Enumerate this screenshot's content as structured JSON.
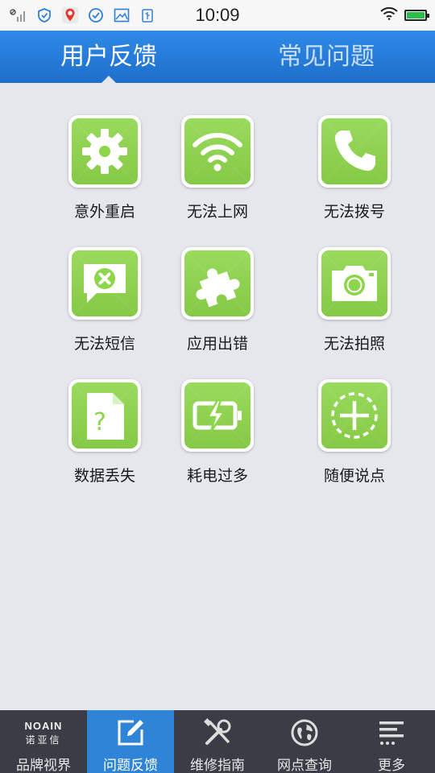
{
  "status_bar": {
    "time": "10:09",
    "icons": [
      "signal-off-icon",
      "shield-check-icon",
      "map-pin-app-icon",
      "check-circle-icon",
      "image-icon",
      "usb-icon"
    ],
    "right_icons": [
      "wifi-icon",
      "battery-icon"
    ],
    "battery_level": 1.0,
    "battery_color": "#2bbf4a"
  },
  "header": {
    "tabs": [
      {
        "label": "用户反馈",
        "active": true
      },
      {
        "label": "常见问题",
        "active": false
      }
    ],
    "color": "#2a7fdc"
  },
  "grid": {
    "tile_color": "#8dd64a",
    "items": [
      {
        "label": "意外重启",
        "icon": "gear-icon"
      },
      {
        "label": "无法上网",
        "icon": "wifi-icon"
      },
      {
        "label": "无法拨号",
        "icon": "phone-icon"
      },
      {
        "label": "无法短信",
        "icon": "message-error-icon"
      },
      {
        "label": "应用出错",
        "icon": "puzzle-icon"
      },
      {
        "label": "无法拍照",
        "icon": "camera-icon"
      },
      {
        "label": "数据丢失",
        "icon": "file-question-icon"
      },
      {
        "label": "耗电过多",
        "icon": "battery-charging-icon"
      },
      {
        "label": "随便说点",
        "icon": "plus-circle-dashed-icon"
      }
    ]
  },
  "bottom_nav": {
    "brand_en": "NOAIN",
    "brand_cn": "诺亚信",
    "items": [
      {
        "label": "品牌视界",
        "icon": "brand-logo-icon",
        "active": false
      },
      {
        "label": "问题反馈",
        "icon": "edit-icon",
        "active": true
      },
      {
        "label": "维修指南",
        "icon": "tools-icon",
        "active": false
      },
      {
        "label": "网点查询",
        "icon": "globe-icon",
        "active": false
      },
      {
        "label": "更多",
        "icon": "menu-icon",
        "active": false
      }
    ]
  }
}
